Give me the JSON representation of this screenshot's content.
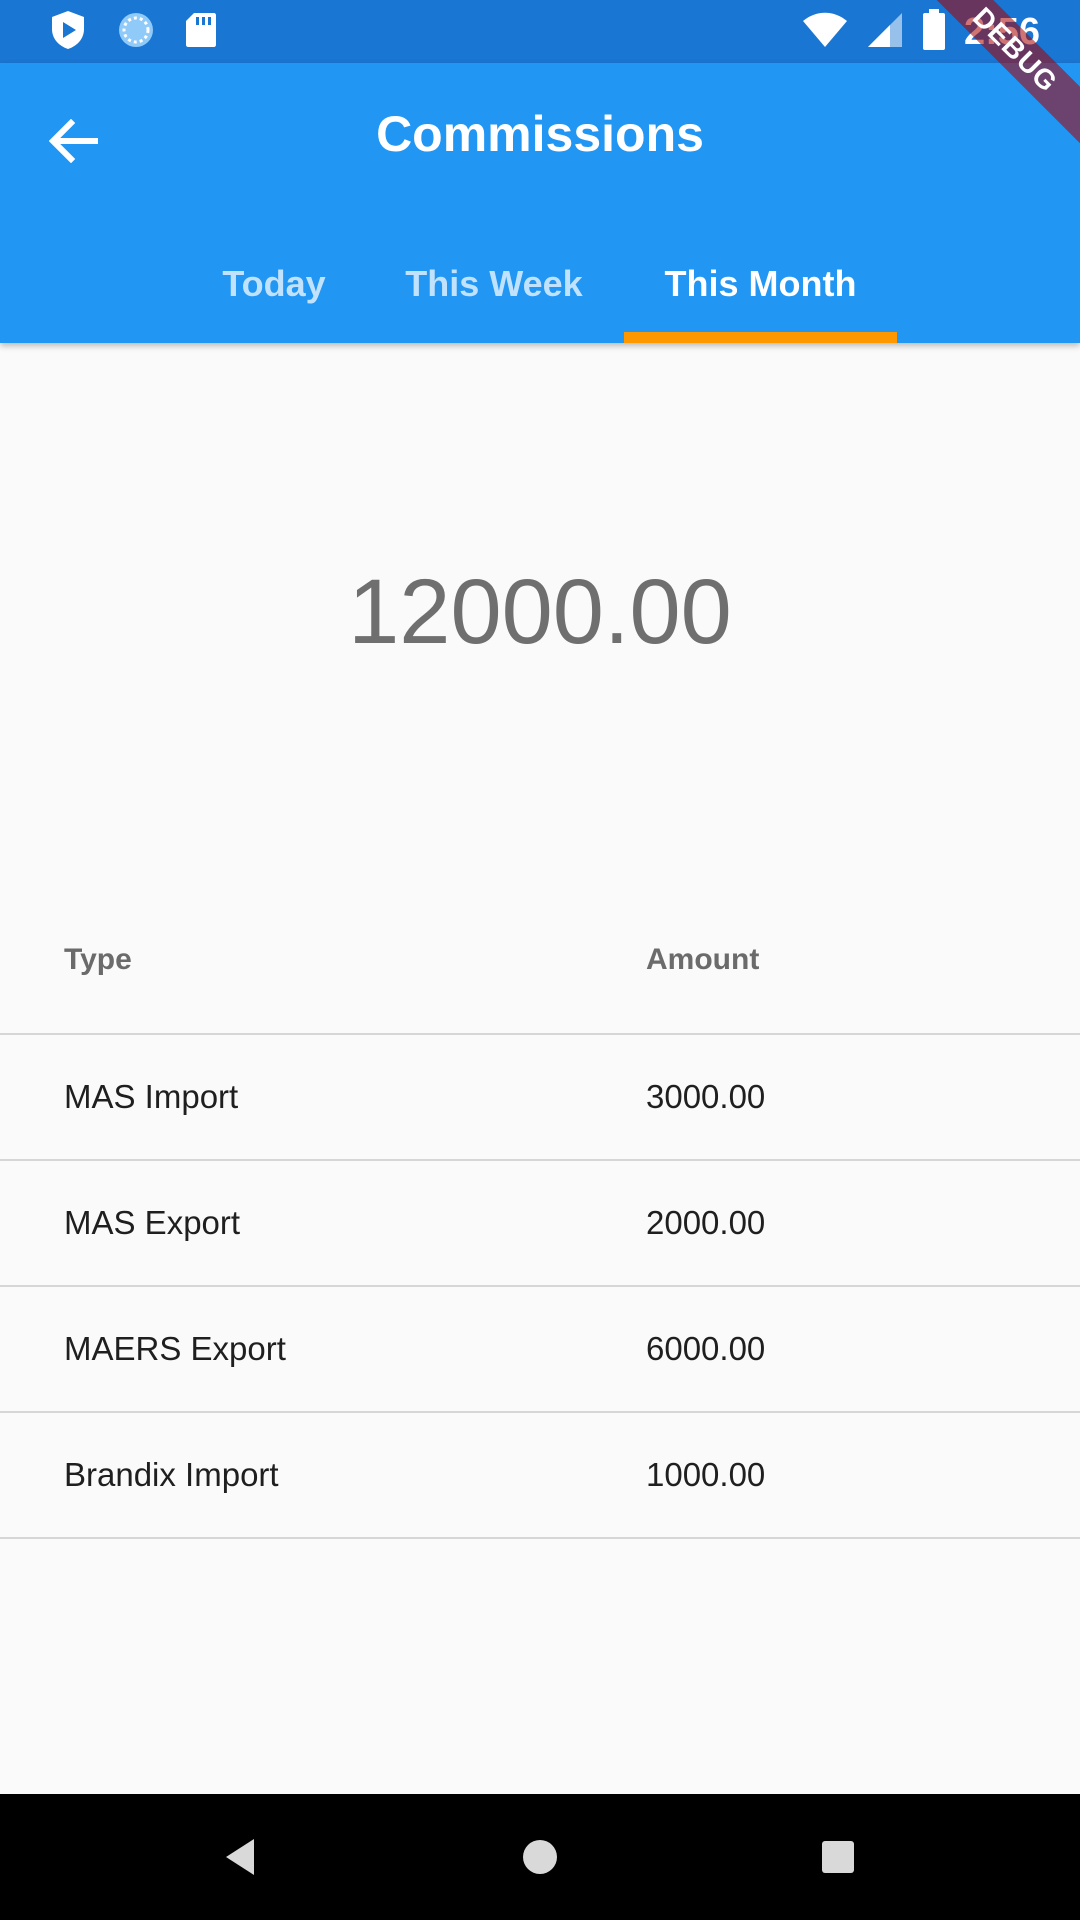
{
  "status_bar": {
    "time": "2:56",
    "icons": [
      "play-protect-icon",
      "sync-icon",
      "sd-card-icon",
      "wifi-icon",
      "cell-signal-icon",
      "battery-icon"
    ]
  },
  "debug_banner": "DEBUG",
  "app_bar": {
    "title": "Commissions",
    "back_icon": "arrow-back-icon",
    "tabs": [
      {
        "label": "Today",
        "active": false
      },
      {
        "label": "This Week",
        "active": false
      },
      {
        "label": "This Month",
        "active": true
      }
    ]
  },
  "summary": {
    "total": "12000.00"
  },
  "table": {
    "headers": {
      "type": "Type",
      "amount": "Amount"
    },
    "rows": [
      {
        "type": "MAS Import",
        "amount": "3000.00"
      },
      {
        "type": "MAS Export",
        "amount": "2000.00"
      },
      {
        "type": "MAERS Export",
        "amount": "6000.00"
      },
      {
        "type": "Brandix Import",
        "amount": "1000.00"
      }
    ]
  },
  "colors": {
    "status_bar": "#1976d2",
    "app_bar": "#2196f3",
    "tab_indicator": "#ff9800",
    "background": "#fafafa"
  },
  "nav_bar": {
    "icons": [
      "back-triangle-icon",
      "home-circle-icon",
      "recents-square-icon"
    ]
  }
}
